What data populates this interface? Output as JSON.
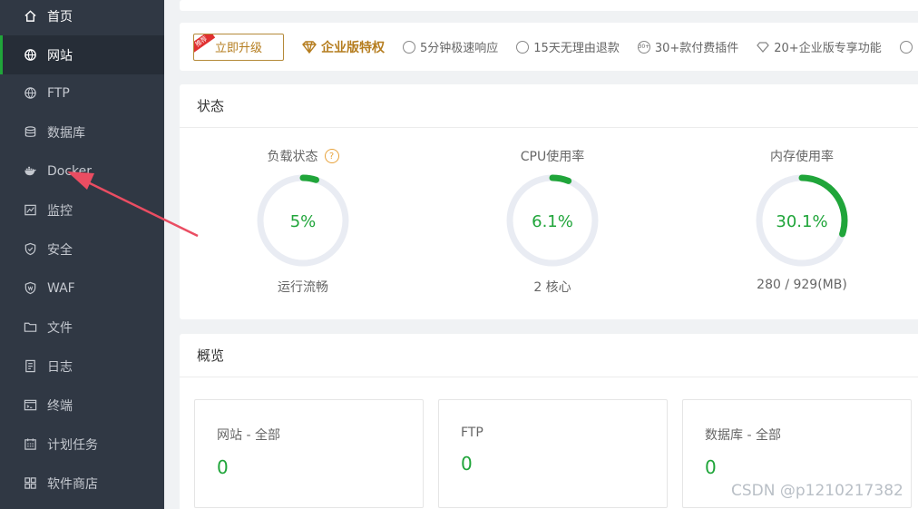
{
  "sidebar": {
    "items": [
      {
        "label": "首页",
        "icon": "home-icon"
      },
      {
        "label": "网站",
        "icon": "globe-icon"
      },
      {
        "label": "FTP",
        "icon": "globe-icon"
      },
      {
        "label": "数据库",
        "icon": "database-icon"
      },
      {
        "label": "Docker",
        "icon": "docker-icon"
      },
      {
        "label": "监控",
        "icon": "monitor-icon"
      },
      {
        "label": "安全",
        "icon": "shield-icon"
      },
      {
        "label": "WAF",
        "icon": "shield-icon"
      },
      {
        "label": "文件",
        "icon": "folder-icon"
      },
      {
        "label": "日志",
        "icon": "log-icon"
      },
      {
        "label": "终端",
        "icon": "terminal-icon"
      },
      {
        "label": "计划任务",
        "icon": "calendar-icon"
      },
      {
        "label": "软件商店",
        "icon": "grid-icon"
      }
    ]
  },
  "promo": {
    "upgrade_label": "立即升级",
    "ribbon": "推荐",
    "enterprise_title": "企业版特权",
    "features": [
      "5分钟极速响应",
      "15天无理由退款",
      "30+款付费插件",
      "20+企业版专享功能"
    ],
    "feature_badge": "30+"
  },
  "status": {
    "title": "状态",
    "help": "?",
    "gauges": [
      {
        "label": "负载状态",
        "value": "5%",
        "sub": "运行流畅",
        "fraction": 0.05
      },
      {
        "label": "CPU使用率",
        "value": "6.1%",
        "sub": "2 核心",
        "fraction": 0.061
      },
      {
        "label": "内存使用率",
        "value": "30.1%",
        "sub": "280 / 929(MB)",
        "fraction": 0.301
      }
    ]
  },
  "overview": {
    "title": "概览",
    "cards": [
      {
        "title": "网站 - 全部",
        "value": "0"
      },
      {
        "title": "FTP",
        "value": "0"
      },
      {
        "title": "数据库 - 全部",
        "value": "0"
      }
    ]
  },
  "watermark": "CSDN @p1210217382",
  "colors": {
    "sidebar_bg": "#303844",
    "accent_green": "#20a53a",
    "gold": "#b57d1f",
    "track": "#e9ecf3",
    "arrow_red": "#ea4d62"
  }
}
